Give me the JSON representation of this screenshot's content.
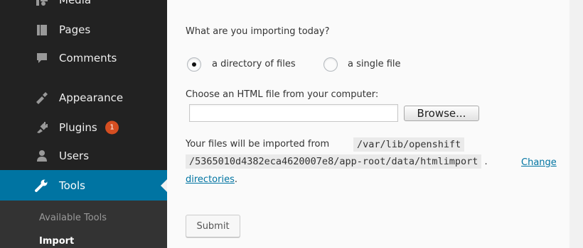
{
  "sidebar": {
    "items": [
      {
        "label": "Media",
        "icon": "media-icon"
      },
      {
        "label": "Pages",
        "icon": "pages-icon"
      },
      {
        "label": "Comments",
        "icon": "comments-icon"
      },
      {
        "label": "Appearance",
        "icon": "appearance-icon"
      },
      {
        "label": "Plugins",
        "icon": "plugins-icon",
        "badge": "1"
      },
      {
        "label": "Users",
        "icon": "users-icon"
      },
      {
        "label": "Tools",
        "icon": "tools-icon",
        "active": true
      }
    ],
    "submenu": {
      "available_tools": "Available Tools",
      "import": "Import"
    }
  },
  "main": {
    "question": "What are you importing today?",
    "options": [
      {
        "label": "a directory of files",
        "checked": true
      },
      {
        "label": "a single file",
        "checked": false
      }
    ],
    "file_prompt": "Choose an HTML file from your computer:",
    "browse_label": "Browse...",
    "import_text_prefix": "Your files will be imported from",
    "path_part1": "/var/lib/openshift",
    "path_part2": "/5365010d4382eca4620007e8/app-root/data/htmlimport",
    "separator": ".",
    "change_link_part1": "Change",
    "change_link_part2": "directories",
    "period": ".",
    "submit_label": "Submit"
  },
  "colors": {
    "sidebar_bg": "#222222",
    "active_bg": "#0074a2",
    "badge_bg": "#d54e21",
    "link": "#0074a2"
  }
}
